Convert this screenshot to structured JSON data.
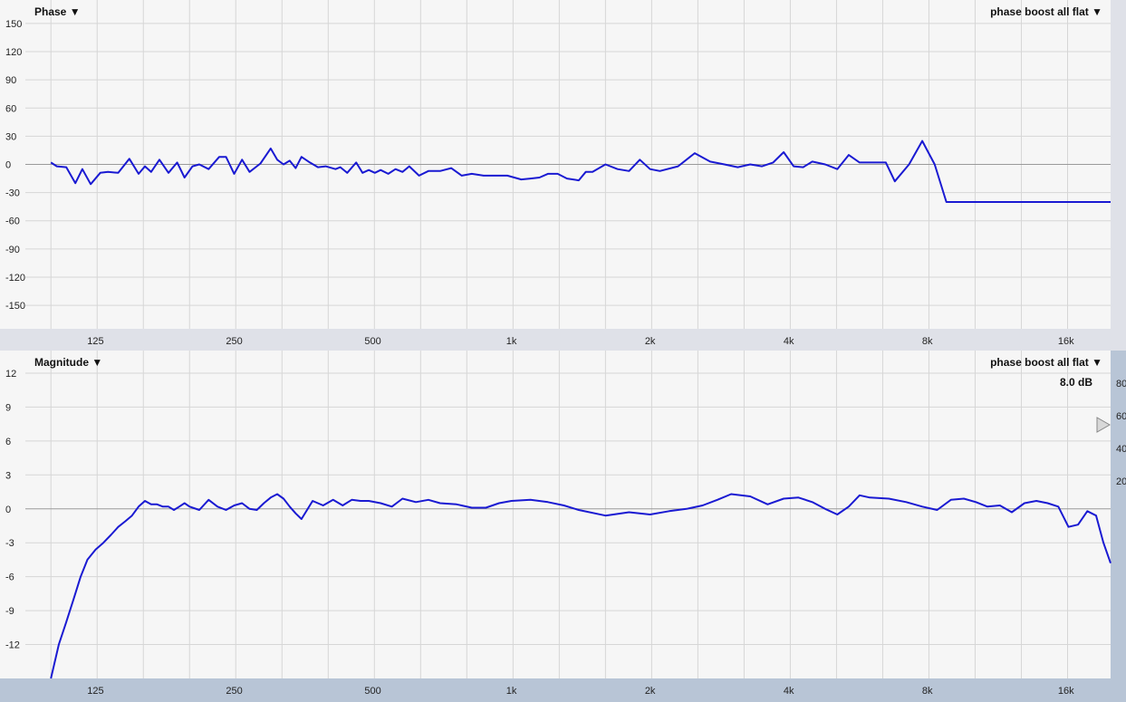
{
  "colors": {
    "plot_bg": "#f6f6f6",
    "grid": "#d6d6d6",
    "zero": "#9a9a9a",
    "trace": "#1a1ad2",
    "phase_panel": "#dfe1e8",
    "mag_panel": "#b8c5d6"
  },
  "phase_panel": {
    "title": "Phase ▼",
    "preset": "phase boost all flat ▼"
  },
  "magnitude_panel": {
    "title": "Magnitude ▼",
    "preset": "phase boost all flat ▼",
    "readout": "8.0 dB",
    "side_scale": [
      "80",
      "60",
      "40",
      "20"
    ],
    "handle_icon": "triangle-right-icon"
  },
  "chart_data": [
    {
      "type": "line",
      "xscale": "log",
      "xlim": [
        88,
        20000
      ],
      "ylim": [
        -175,
        175
      ],
      "yticks": [
        "150",
        "120",
        "90",
        "60",
        "30",
        "0",
        "-30",
        "-60",
        "-90",
        "-120",
        "-150"
      ],
      "ytick_values": [
        150,
        120,
        90,
        60,
        30,
        0,
        -30,
        -60,
        -90,
        -120,
        -150
      ],
      "xticks": [
        "125",
        "250",
        "500",
        "1k",
        "2k",
        "4k",
        "8k",
        "16k"
      ],
      "xtick_values": [
        125,
        250,
        500,
        1000,
        2000,
        4000,
        8000,
        16000
      ],
      "grid": true,
      "series": [
        {
          "x": [
            100,
            103,
            108,
            113,
            117,
            122,
            128,
            133,
            140,
            148,
            155,
            160,
            165,
            172,
            180,
            188,
            195,
            203,
            210,
            220,
            232,
            240,
            250,
            260,
            270,
            285,
            300,
            310,
            320,
            330,
            340,
            350,
            365,
            380,
            395,
            415,
            425,
            440,
            460,
            475,
            490,
            505,
            520,
            540,
            560,
            580,
            600,
            630,
            660,
            700,
            740,
            780,
            820,
            870,
            920,
            980,
            1050,
            1100,
            1150,
            1200,
            1260,
            1320,
            1400,
            1450,
            1500,
            1600,
            1700,
            1800,
            1900,
            2000,
            2100,
            2300,
            2500,
            2700,
            2900,
            3100,
            3300,
            3500,
            3700,
            3900,
            4100,
            4300,
            4500,
            4800,
            5100,
            5400,
            5700,
            6100,
            6500,
            6800,
            7300,
            7800,
            8300,
            8800,
            9200,
            9600,
            10200,
            10800,
            11500,
            12200,
            13000,
            13600,
            14200,
            15000,
            15800,
            16300,
            17000,
            17600,
            18100,
            18600,
            19000,
            19500,
            20000
          ],
          "y": [
            2,
            -2,
            -3,
            -20,
            -5,
            -21,
            -9,
            -8,
            -9,
            6,
            -10,
            -2,
            -8,
            5,
            -9,
            2,
            -14,
            -2,
            0,
            -5,
            8,
            8,
            -10,
            5,
            -8,
            1,
            17,
            5,
            0,
            4,
            -4,
            8,
            2,
            -3,
            -2,
            -5,
            -3,
            -9,
            2,
            -9,
            -6,
            -9,
            -6,
            -10,
            -5,
            -8,
            -2,
            -12,
            -7,
            -7,
            -4,
            -12,
            -10,
            -12,
            -12,
            -12,
            -16,
            -15,
            -14,
            -10,
            -10,
            -15,
            -17,
            -8,
            -8,
            0,
            -5,
            -7,
            5,
            -5,
            -7,
            -2,
            12,
            3,
            0,
            -3,
            0,
            -2,
            2,
            13,
            -2,
            -3,
            3,
            0,
            -5,
            10,
            2,
            2,
            2,
            -18,
            0,
            25,
            0,
            -40,
            -40,
            -40,
            -40,
            -40,
            -40,
            -40,
            -40,
            -40,
            -40,
            -40,
            -40,
            -40,
            -40,
            -40,
            -40,
            -40,
            -40,
            -40,
            -40
          ]
        }
      ]
    },
    {
      "type": "line",
      "xscale": "log",
      "xlim": [
        88,
        20000
      ],
      "ylim": [
        -15,
        14
      ],
      "yticks": [
        "12",
        "9",
        "6",
        "3",
        "0",
        "-3",
        "-6",
        "-9",
        "-12"
      ],
      "ytick_values": [
        12,
        9,
        6,
        3,
        0,
        -3,
        -6,
        -9,
        -12
      ],
      "xticks": [
        "125",
        "250",
        "500",
        "1k",
        "2k",
        "4k",
        "8k",
        "16k"
      ],
      "xtick_values": [
        125,
        250,
        500,
        1000,
        2000,
        4000,
        8000,
        16000
      ],
      "grid": true,
      "series": [
        {
          "x": [
            100,
            104,
            108,
            112,
            116,
            120,
            125,
            130,
            135,
            140,
            145,
            150,
            155,
            160,
            165,
            170,
            175,
            180,
            185,
            190,
            195,
            200,
            210,
            220,
            230,
            240,
            250,
            260,
            270,
            280,
            290,
            300,
            310,
            320,
            330,
            340,
            350,
            370,
            390,
            410,
            430,
            450,
            470,
            490,
            520,
            550,
            580,
            620,
            660,
            700,
            760,
            820,
            880,
            940,
            1000,
            1100,
            1200,
            1300,
            1400,
            1600,
            1800,
            2000,
            2200,
            2400,
            2600,
            2800,
            3000,
            3300,
            3600,
            3900,
            4200,
            4500,
            4800,
            5100,
            5400,
            5700,
            6000,
            6600,
            7200,
            7800,
            8400,
            9000,
            9600,
            10200,
            10800,
            11500,
            12200,
            13000,
            13800,
            14600,
            15400,
            16200,
            17000,
            17800,
            18600,
            19300,
            20000
          ],
          "y": [
            -15,
            -12,
            -10,
            -8,
            -6,
            -4.5,
            -3.6,
            -3,
            -2.3,
            -1.6,
            -1.1,
            -0.6,
            0.2,
            0.7,
            0.4,
            0.4,
            0.2,
            0.2,
            -0.1,
            0.2,
            0.5,
            0.2,
            -0.1,
            0.8,
            0.2,
            -0.1,
            0.3,
            0.5,
            0,
            -0.1,
            0.5,
            1,
            1.3,
            0.9,
            0.2,
            -0.4,
            -0.9,
            0.7,
            0.3,
            0.8,
            0.3,
            0.8,
            0.7,
            0.7,
            0.5,
            0.2,
            0.9,
            0.6,
            0.8,
            0.5,
            0.4,
            0.1,
            0.1,
            0.5,
            0.7,
            0.8,
            0.6,
            0.3,
            -0.1,
            -0.6,
            -0.3,
            -0.5,
            -0.2,
            0,
            0.3,
            0.8,
            1.3,
            1.1,
            0.4,
            0.9,
            1,
            0.6,
            0,
            -0.5,
            0.2,
            1.2,
            1,
            0.9,
            0.6,
            0.2,
            -0.1,
            0.8,
            0.9,
            0.6,
            0.2,
            0.3,
            -0.3,
            0.5,
            0.7,
            0.5,
            0.2,
            -1.6,
            -1.4,
            -0.2,
            -0.6,
            -3,
            -4.8
          ]
        }
      ]
    }
  ]
}
